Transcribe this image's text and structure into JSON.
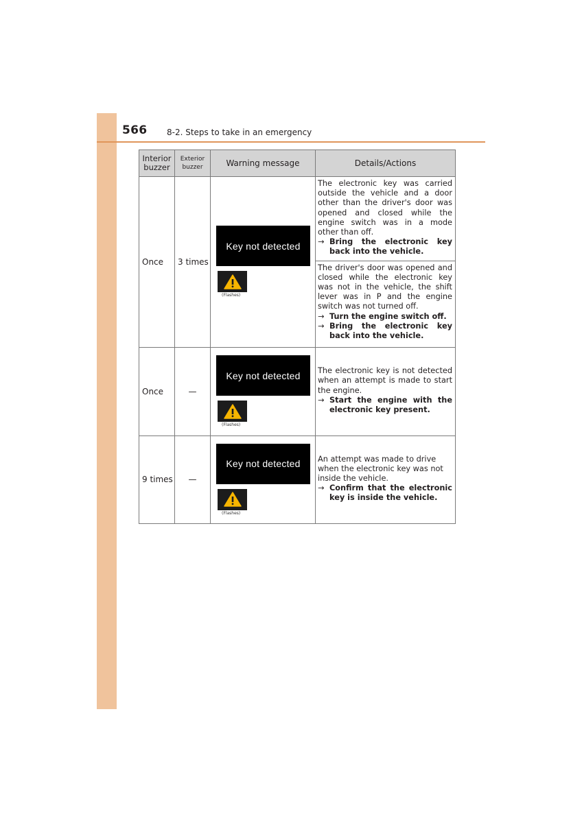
{
  "header": {
    "page_number": "566",
    "section_title": "8-2. Steps to take in an emergency"
  },
  "table": {
    "columns": [
      "Interior buzzer",
      "Exterior buzzer",
      "Warning message",
      "Details/Actions"
    ],
    "column_lines": [
      [
        "Interior",
        "buzzer"
      ],
      [
        "Exterior",
        "buzzer"
      ]
    ],
    "display_message": "Key not detected",
    "flashes_label": "(Flashes)",
    "arrow": "→",
    "rows": [
      {
        "interior": "Once",
        "exterior": "3 times",
        "details": [
          {
            "text": "The electronic key was carried outside the vehicle and a door other than the driver's door was opened and closed while the engine switch was in a mode other than off.",
            "actions": [
              "Bring the electronic key back into the vehicle."
            ]
          },
          {
            "text": "The driver's door was opened and closed while the electronic key was not in the vehicle, the shift lever was in P and the engine switch was not turned off.",
            "actions": [
              "Turn the engine switch off.",
              "Bring the electronic key back into the vehicle."
            ]
          }
        ]
      },
      {
        "interior": "Once",
        "exterior": "—",
        "details": [
          {
            "text": "The electronic key is not detected when an attempt is made to start the engine.",
            "actions": [
              "Start the engine with the electronic key present."
            ]
          }
        ]
      },
      {
        "interior": "9 times",
        "exterior": "—",
        "details": [
          {
            "text": "An attempt was made to drive when the electronic key was not inside the vehicle.",
            "actions": [
              "Confirm that the electronic key is inside the vehicle."
            ]
          }
        ]
      }
    ]
  },
  "colors": {
    "sidebar": "#f0c39c",
    "header_rule": "#e0955a",
    "table_header_bg": "#d4d4d4",
    "warning_icon": "#f7b500"
  }
}
